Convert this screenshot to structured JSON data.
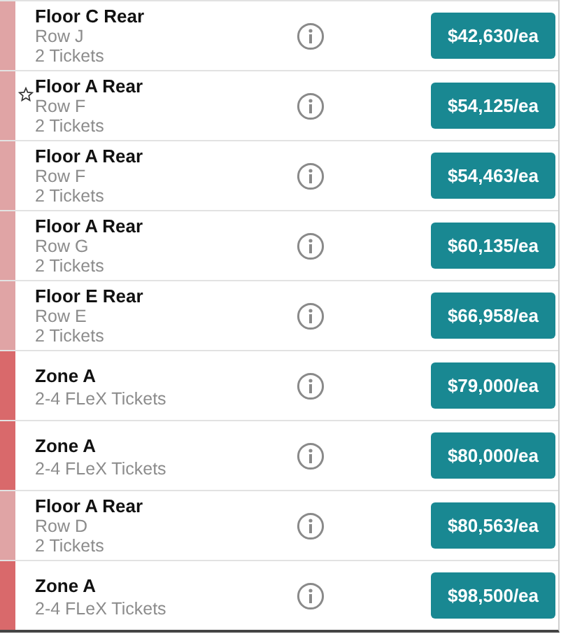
{
  "listings": [
    {
      "section": "Floor C Rear",
      "lines": [
        "Row J",
        "2 Tickets"
      ],
      "kind": "standard",
      "color": "#e0a4a5",
      "starred": false,
      "price": "$42,630/ea"
    },
    {
      "section": "Floor A Rear",
      "lines": [
        "Row F",
        "2 Tickets"
      ],
      "kind": "standard",
      "color": "#e0a4a5",
      "starred": true,
      "price": "$54,125/ea"
    },
    {
      "section": "Floor A Rear",
      "lines": [
        "Row F",
        "2 Tickets"
      ],
      "kind": "standard",
      "color": "#e0a4a5",
      "starred": false,
      "price": "$54,463/ea"
    },
    {
      "section": "Floor A Rear",
      "lines": [
        "Row G",
        "2 Tickets"
      ],
      "kind": "standard",
      "color": "#e0a4a5",
      "starred": false,
      "price": "$60,135/ea"
    },
    {
      "section": "Floor E Rear",
      "lines": [
        "Row E",
        "2 Tickets"
      ],
      "kind": "standard",
      "color": "#e0a4a5",
      "starred": false,
      "price": "$66,958/ea"
    },
    {
      "section": "Zone A",
      "lines": [
        "2-4 FLeX Tickets"
      ],
      "kind": "flex",
      "color": "#d9696b",
      "starred": false,
      "price": "$79,000/ea"
    },
    {
      "section": "Zone A",
      "lines": [
        "2-4 FLeX Tickets"
      ],
      "kind": "flex",
      "color": "#d9696b",
      "starred": false,
      "price": "$80,000/ea"
    },
    {
      "section": "Floor A Rear",
      "lines": [
        "Row D",
        "2 Tickets"
      ],
      "kind": "standard",
      "color": "#e0a4a5",
      "starred": false,
      "price": "$80,563/ea"
    },
    {
      "section": "Zone A",
      "lines": [
        "2-4 FLeX Tickets"
      ],
      "kind": "flex",
      "color": "#d9696b",
      "starred": false,
      "price": "$98,500/ea"
    }
  ]
}
